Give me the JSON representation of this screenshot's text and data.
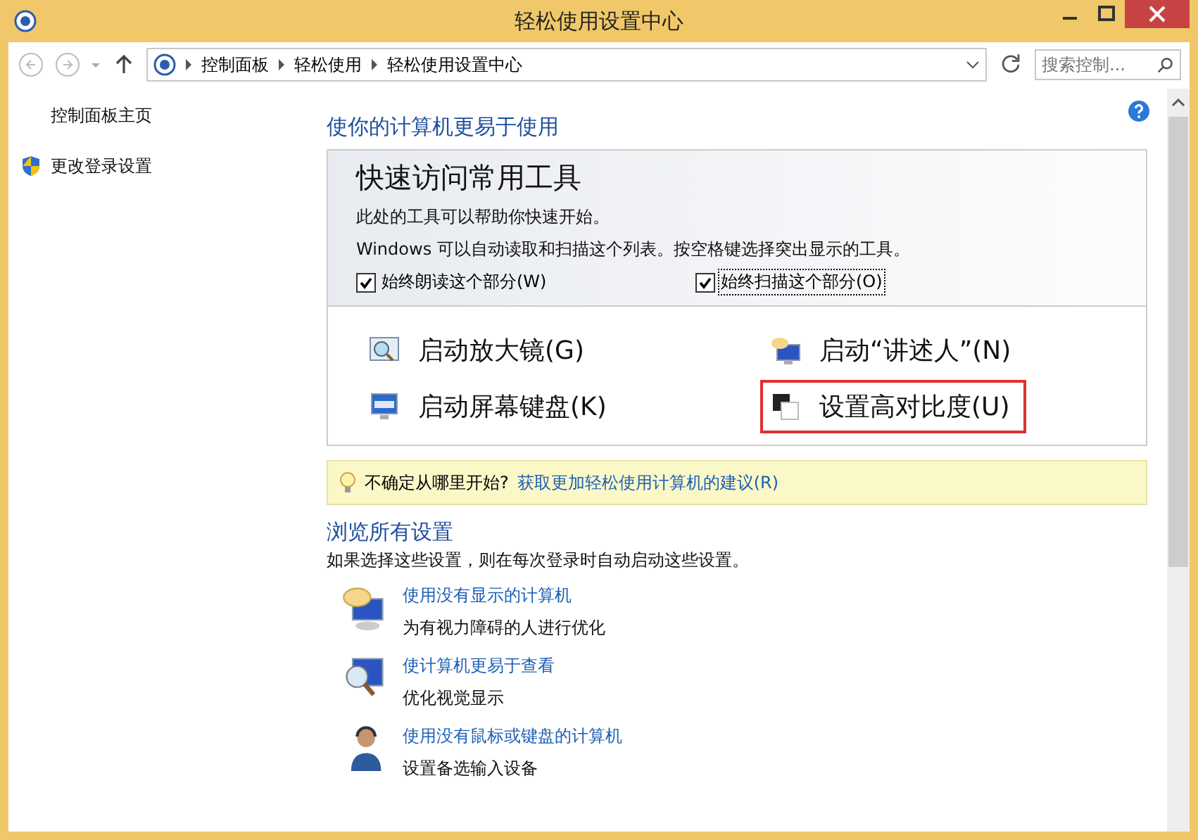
{
  "window": {
    "title": "轻松使用设置中心"
  },
  "nav": {
    "breadcrumb": [
      "控制面板",
      "轻松使用",
      "轻松使用设置中心"
    ],
    "search": {
      "placeholder": "搜索控制..."
    }
  },
  "sidebar": {
    "items": [
      {
        "label": "控制面板主页",
        "kind": "plain"
      },
      {
        "label": "更改登录设置",
        "kind": "shield"
      }
    ]
  },
  "heading": "使你的计算机更易于使用",
  "quick_access": {
    "title": "快速访问常用工具",
    "lines": [
      "此处的工具可以帮助你快速开始。",
      "Windows 可以自动读取和扫描这个列表。按空格键选择突出显示的工具。"
    ],
    "options": [
      {
        "label": "始终朗读这个部分(W)",
        "checked": true,
        "focused": false
      },
      {
        "label": "始终扫描这个部分(O)",
        "checked": true,
        "focused": true
      }
    ],
    "tools": [
      {
        "label": "启动放大镜(G)",
        "kind": "magnifier",
        "highlighted": false
      },
      {
        "label": "启动“讲述人”(N)",
        "kind": "narrator",
        "highlighted": false
      },
      {
        "label": "启动屏幕键盘(K)",
        "kind": "keyboard",
        "highlighted": false
      },
      {
        "label": "设置高对比度(U)",
        "kind": "contrast",
        "highlighted": true
      }
    ]
  },
  "tip": {
    "text": "不确定从哪里开始?",
    "link": "获取更加轻松使用计算机的建议(R)"
  },
  "browse": {
    "title": "浏览所有设置",
    "description": "如果选择这些设置，则在每次登录时自动启动这些设置。",
    "items": [
      {
        "link": "使用没有显示的计算机",
        "description": "为有视力障碍的人进行优化",
        "kind": "speech"
      },
      {
        "link": "使计算机更易于查看",
        "description": "优化视觉显示",
        "kind": "magnifier"
      },
      {
        "link": "使用没有鼠标或键盘的计算机",
        "description": "设置备选输入设备",
        "kind": "person"
      }
    ]
  }
}
